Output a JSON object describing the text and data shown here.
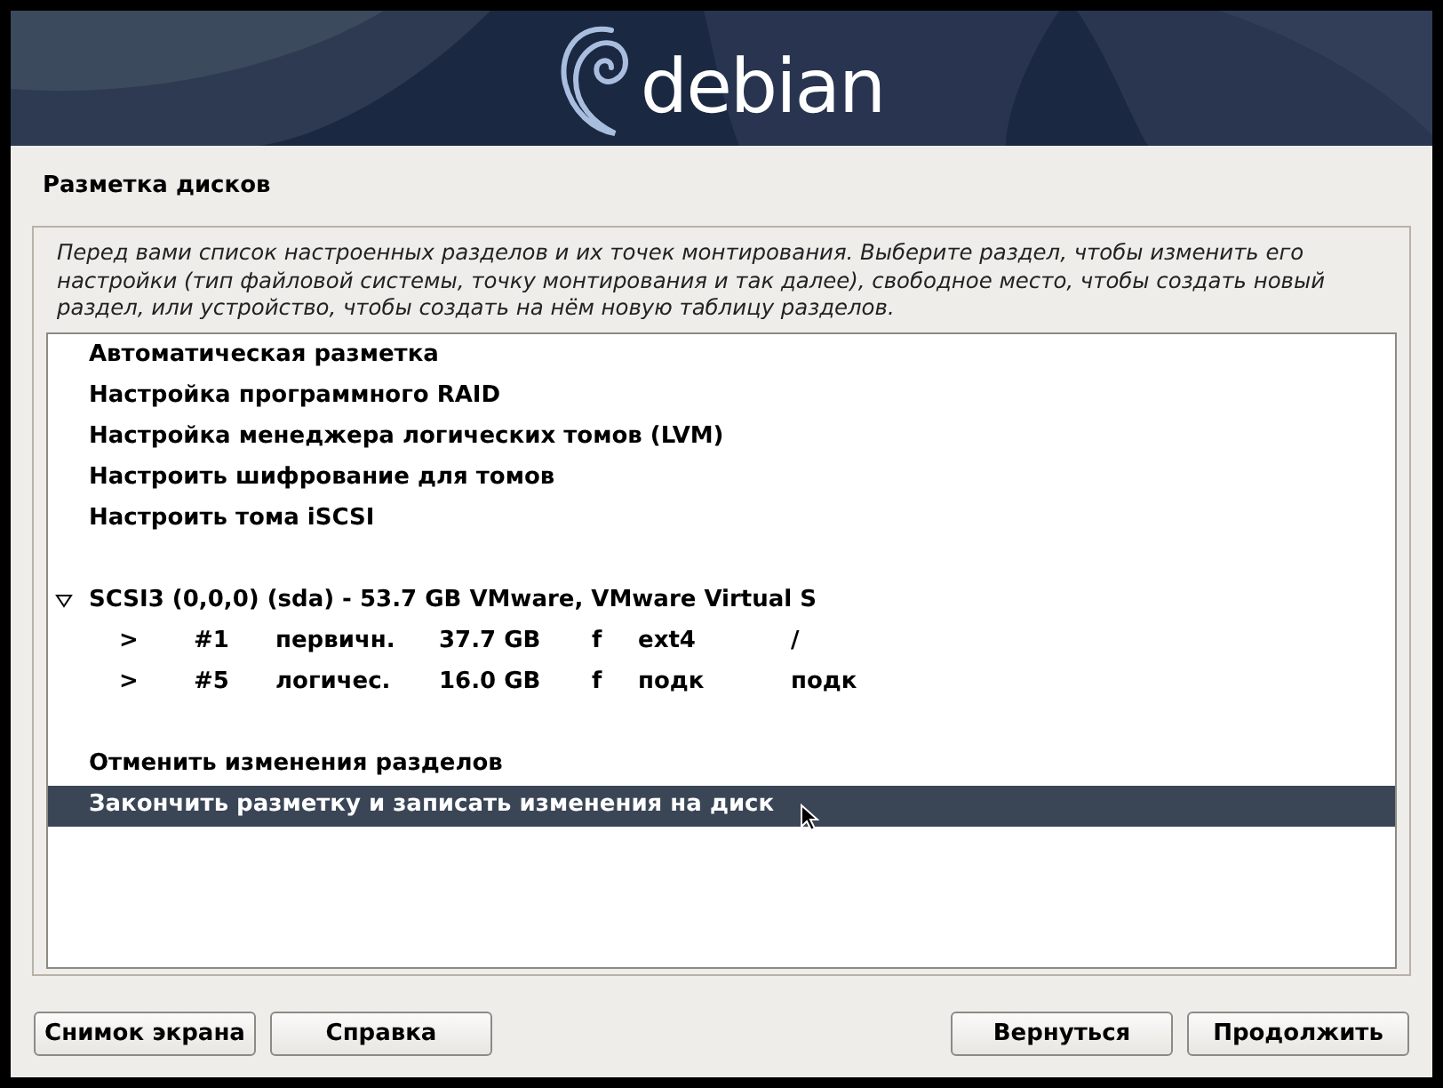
{
  "banner": {
    "logo_text": "debian"
  },
  "title": "Разметка дисков",
  "description": "Перед вами список настроенных разделов и их точек монтирования. Выберите раздел, чтобы изменить его настройки (тип файловой системы, точку монтирования и так далее), свободное место, чтобы создать новый раздел, или устройство, чтобы создать на нём новую таблицу разделов.",
  "items": [
    {
      "kind": "action",
      "label": "Автоматическая разметка",
      "selected": false
    },
    {
      "kind": "action",
      "label": "Настройка программного RAID",
      "selected": false
    },
    {
      "kind": "action",
      "label": "Настройка менеджера логических томов (LVM)",
      "selected": false
    },
    {
      "kind": "action",
      "label": "Настроить шифрование для томов",
      "selected": false
    },
    {
      "kind": "action",
      "label": "Настроить тома iSCSI",
      "selected": false
    },
    {
      "kind": "gap"
    },
    {
      "kind": "disk",
      "label": "SCSI3 (0,0,0) (sda) - 53.7 GB VMware, VMware Virtual S",
      "expanded": true,
      "selected": false
    },
    {
      "kind": "partition",
      "cells": [
        ">",
        "#1",
        "первичн.",
        "37.7 GB",
        "f",
        "ext4",
        "/"
      ],
      "selected": false
    },
    {
      "kind": "partition",
      "cells": [
        ">",
        "#5",
        "логичес.",
        "16.0 GB",
        "f",
        "подк",
        "подк"
      ],
      "selected": false
    },
    {
      "kind": "gap"
    },
    {
      "kind": "action",
      "label": "Отменить изменения разделов",
      "selected": false
    },
    {
      "kind": "action",
      "label": "Закончить разметку и записать изменения на диск",
      "selected": true
    }
  ],
  "buttons_left": [
    "Снимок экрана",
    "Справка"
  ],
  "buttons_right": [
    "Вернуться",
    "Продолжить"
  ]
}
